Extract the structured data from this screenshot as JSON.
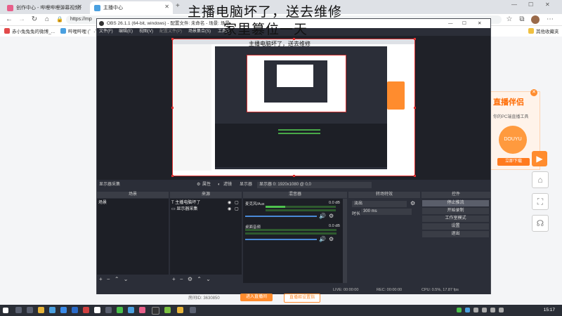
{
  "browser": {
    "tabs": [
      {
        "label": "创作中心 - 哔哩哔哩弹幕视频网 - ...",
        "color": "#e85f8a"
      },
      {
        "label": "主播中心",
        "color": "#4aa0e0"
      }
    ],
    "url": "https://mp",
    "bookmarks": [
      {
        "label": "赤小兔兔兔的微博_...",
        "color": "#e24a4a"
      },
      {
        "label": "哔哩哔哩 (゜-゜)",
        "color": "#4aa0e0"
      }
    ],
    "other_bookmarks": "其他收藏夹"
  },
  "overlay": {
    "line1": "主播电脑坏了，送去维修",
    "line2": "家里篡位一天"
  },
  "obs": {
    "title": "OBS 26.1.1 (64-bit, windows) - 配置文件: 未命名 - 场景: 场景",
    "menu": [
      "文件(F)",
      "编辑(E)",
      "视图(V)",
      "配置文件(P)",
      "场景集合(S)",
      "工具(T)"
    ],
    "scenebar": {
      "source_label": "显示器采集",
      "properties": "属性",
      "filters": "滤镜",
      "display_label": "显示器",
      "display_value": "显示器 0: 1920x1080 @ 0,0"
    },
    "docks": {
      "scenes": "场景",
      "sources": "来源",
      "mixer": "混音器",
      "transitions": "转场特效",
      "controls": "控件"
    },
    "scenes": [
      "场景"
    ],
    "sources": [
      {
        "label": "主播电脑坏了",
        "icon": "text-icon"
      },
      {
        "label": "显示器采集",
        "icon": "monitor-icon"
      }
    ],
    "mixer": [
      {
        "name": "麦克风/Aux",
        "db": "0.0 dB",
        "level": 0.28
      },
      {
        "name": "桌面音频",
        "db": "0.0 dB",
        "level": 0.0
      }
    ],
    "transitions": {
      "type": "淡出",
      "duration_label": "时长",
      "duration": "300 ms"
    },
    "controls": [
      "停止推流",
      "开始录制",
      "工作室模式",
      "设置",
      "退出"
    ],
    "status": {
      "live": "LIVE: 00:00:00",
      "rec": "REC: 00:00:00",
      "cpu": "CPU: 0.5%, 17.87 fps"
    },
    "nested_text": "主播电脑坏了，送去维修"
  },
  "page": {
    "id_label": "房间ID: 3630850",
    "btn1": "进入直播间",
    "btn2": "直播姬设置指",
    "ad_title": "直播伴侣",
    "ad_sub": "你的PC端直播工具",
    "ad_btn": "立即下载"
  },
  "taskbar": {
    "time": "15:17"
  },
  "colors": {
    "accent": "#ff8c2e",
    "preview_border": "#e03030",
    "obs_bg": "#2b2e38"
  }
}
